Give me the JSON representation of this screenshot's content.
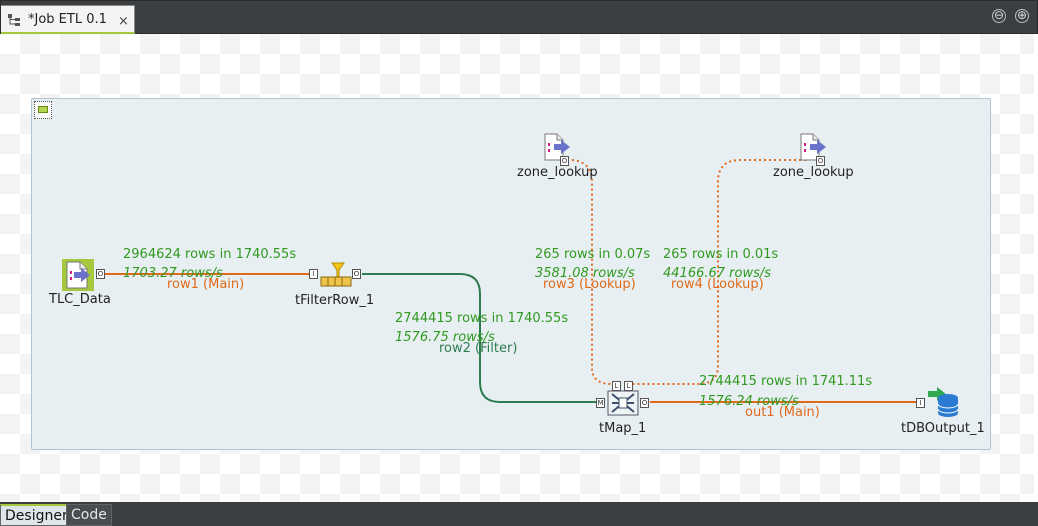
{
  "editor_tab": {
    "title": "*Job ETL 0.1",
    "close_glyph": "×",
    "icon": "job-icon"
  },
  "window_controls": {
    "minimize_glyph": "⊖",
    "maximize_glyph": "⊕"
  },
  "components": {
    "tlc_data": "TLC_Data",
    "tfilterrow": "tFilterRow_1",
    "zone_lookup_1": "zone_lookup",
    "zone_lookup_2": "zone_lookup",
    "tmap": "tMap_1",
    "tdboutput": "tDBOutput_1"
  },
  "links": {
    "row1": {
      "label": "row1 (Main)",
      "rows": "2964624 rows in 1740.55s",
      "rate": "1703.27 rows/s"
    },
    "row2": {
      "label": "row2 (Filter)",
      "rows": "2744415 rows in 1740.55s",
      "rate": "1576.75 rows/s"
    },
    "row3": {
      "label": "row3 (Lookup)",
      "rows": "265 rows in 0.07s",
      "rate": "3581.08 rows/s"
    },
    "row4": {
      "label": "row4 (Lookup)",
      "rows": "265 rows in 0.01s",
      "rate": "44166.67 rows/s"
    },
    "out1": {
      "label": "out1 (Main)",
      "rows": "2744415 rows in 1741.11s",
      "rate": "1576.24 rows/s"
    }
  },
  "connector_marks": {
    "main_in": "I",
    "main_out": "O",
    "tmap_main": "M",
    "tmap_lookup": "L"
  },
  "bottom_tabs": [
    "Designer",
    "Code"
  ],
  "colors": {
    "main_link": "#e16a1a",
    "filter_link": "#2e7d4f",
    "stat_text": "#2f9a1e",
    "accent": "#a6c83c"
  }
}
